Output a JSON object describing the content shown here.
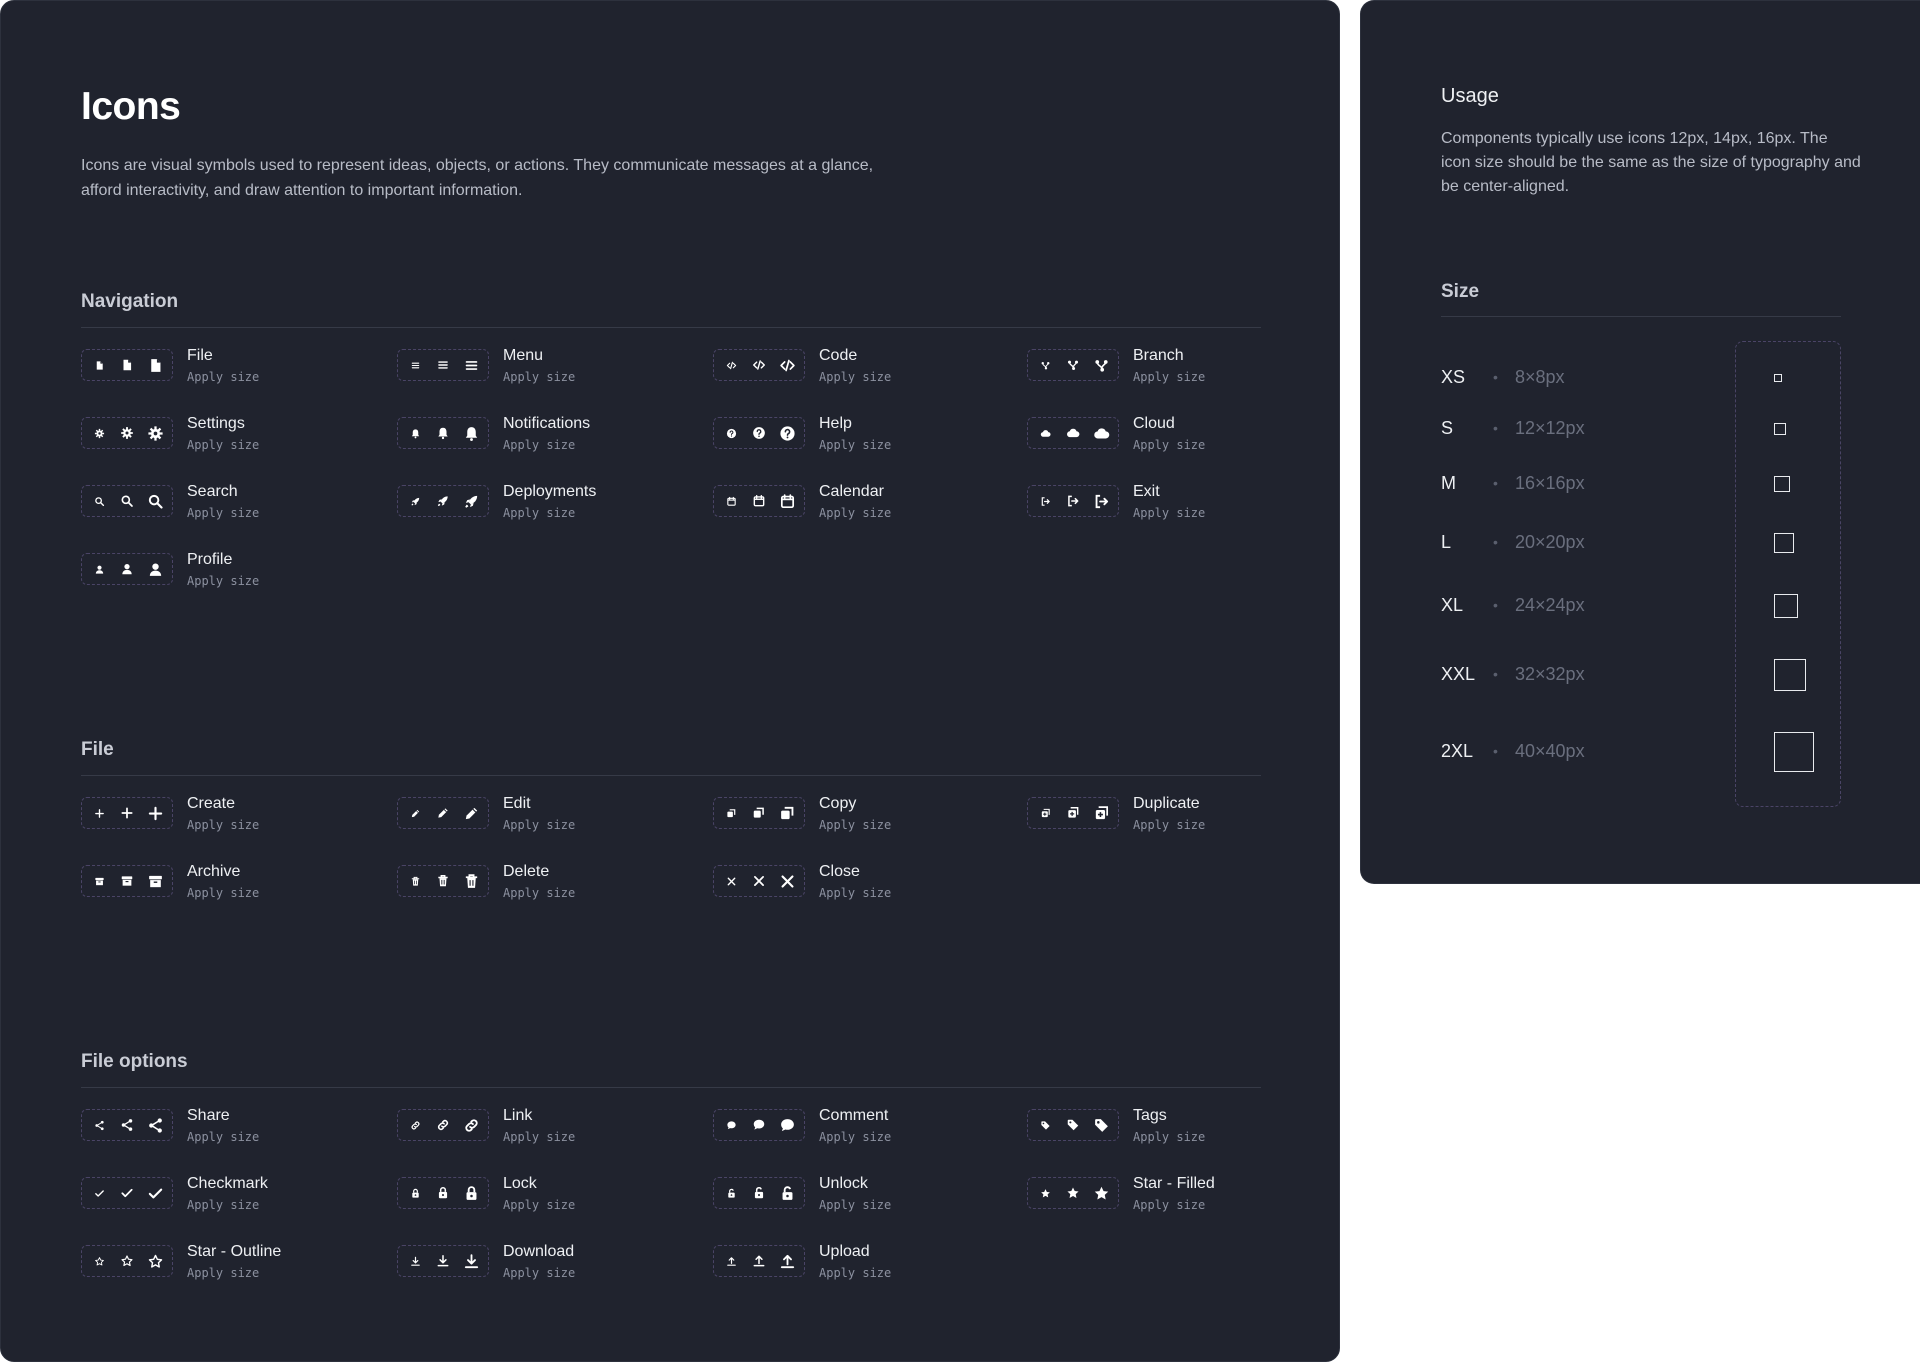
{
  "page": {
    "title": "Icons",
    "intro": "Icons are visual symbols used to represent ideas, objects, or actions. They communicate messages at a glance, afford interactivity, and draw attention to important information."
  },
  "sections": [
    {
      "title": "Navigation",
      "items": [
        {
          "name": "File",
          "sub": "Apply size",
          "icon": "file-icon"
        },
        {
          "name": "Menu",
          "sub": "Apply size",
          "icon": "menu-icon"
        },
        {
          "name": "Code",
          "sub": "Apply size",
          "icon": "code-icon"
        },
        {
          "name": "Branch",
          "sub": "Apply size",
          "icon": "branch-icon"
        },
        {
          "name": "Settings",
          "sub": "Apply size",
          "icon": "gear-icon"
        },
        {
          "name": "Notifications",
          "sub": "Apply size",
          "icon": "bell-icon"
        },
        {
          "name": "Help",
          "sub": "Apply size",
          "icon": "help-icon"
        },
        {
          "name": "Cloud",
          "sub": "Apply size",
          "icon": "cloud-icon"
        },
        {
          "name": "Search",
          "sub": "Apply size",
          "icon": "search-icon"
        },
        {
          "name": "Deployments",
          "sub": "Apply size",
          "icon": "rocket-icon"
        },
        {
          "name": "Calendar",
          "sub": "Apply size",
          "icon": "calendar-icon"
        },
        {
          "name": "Exit",
          "sub": "Apply size",
          "icon": "exit-icon"
        },
        {
          "name": "Profile",
          "sub": "Apply size",
          "icon": "user-icon"
        }
      ]
    },
    {
      "title": "File",
      "items": [
        {
          "name": "Create",
          "sub": "Apply size",
          "icon": "plus-icon"
        },
        {
          "name": "Edit",
          "sub": "Apply size",
          "icon": "pencil-icon"
        },
        {
          "name": "Copy",
          "sub": "Apply size",
          "icon": "copy-icon"
        },
        {
          "name": "Duplicate",
          "sub": "Apply size",
          "icon": "duplicate-icon"
        },
        {
          "name": "Archive",
          "sub": "Apply size",
          "icon": "archive-icon"
        },
        {
          "name": "Delete",
          "sub": "Apply size",
          "icon": "trash-icon"
        },
        {
          "name": "Close",
          "sub": "Apply size",
          "icon": "close-icon"
        }
      ]
    },
    {
      "title": "File options",
      "items": [
        {
          "name": "Share",
          "sub": "Apply size",
          "icon": "share-icon"
        },
        {
          "name": "Link",
          "sub": "Apply size",
          "icon": "link-icon"
        },
        {
          "name": "Comment",
          "sub": "Apply size",
          "icon": "comment-icon"
        },
        {
          "name": "Tags",
          "sub": "Apply size",
          "icon": "tag-icon"
        },
        {
          "name": "Checkmark",
          "sub": "Apply size",
          "icon": "check-icon"
        },
        {
          "name": "Lock",
          "sub": "Apply size",
          "icon": "lock-icon"
        },
        {
          "name": "Unlock",
          "sub": "Apply size",
          "icon": "unlock-icon"
        },
        {
          "name": "Star - Filled",
          "sub": "Apply size",
          "icon": "star-filled-icon"
        },
        {
          "name": "Star - Outline",
          "sub": "Apply size",
          "icon": "star-outline-icon"
        },
        {
          "name": "Download",
          "sub": "Apply size",
          "icon": "download-icon"
        },
        {
          "name": "Upload",
          "sub": "Apply size",
          "icon": "upload-icon"
        }
      ]
    }
  ],
  "usage": {
    "title": "Usage",
    "text": "Components typically use icons 12px, 14px, 16px. The icon size should be the same as the size of typography and be center-aligned."
  },
  "size": {
    "title": "Size",
    "rows": [
      {
        "label": "XS",
        "value": "8×8px"
      },
      {
        "label": "S",
        "value": "12×12px"
      },
      {
        "label": "M",
        "value": "16×16px"
      },
      {
        "label": "L",
        "value": "20×20px"
      },
      {
        "label": "XL",
        "value": "24×24px"
      },
      {
        "label": "XXL",
        "value": "32×32px"
      },
      {
        "label": "2XL",
        "value": "40×40px"
      }
    ]
  },
  "colors": {
    "panel": "#20232e",
    "outline": "#4a4466",
    "text": "#eef0f3",
    "muted": "#8c91a0"
  }
}
